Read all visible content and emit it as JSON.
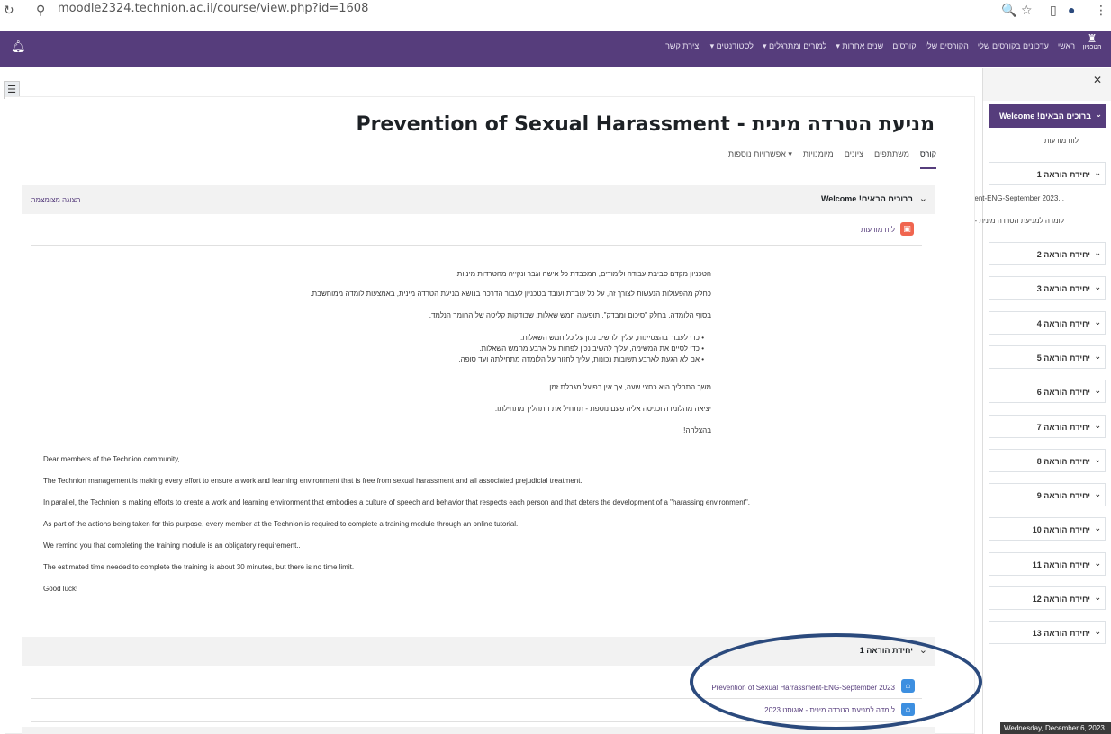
{
  "browser": {
    "url": "moodle2324.technion.ac.il/course/view.php?id=1608"
  },
  "navbar": {
    "logo_text": "הטכניון",
    "items": [
      "ראשי",
      "עדכונים בקורסים שלי",
      "הקורסים שלי",
      "קורסים",
      "שנים אחרות ▾",
      "למורים ומתרגלים ▾",
      "לסטודנטים ▾",
      "יצירת קשר"
    ]
  },
  "course": {
    "title": "מניעת הטרדה מינית - Prevention of Sexual Harassment",
    "tabs": [
      "קורס",
      "משתתפים",
      "ציונים",
      "מיומנויות",
      "אפשרויות נוספות ▾"
    ]
  },
  "welcome_section": {
    "title": "ברוכים הבאים! Welcome",
    "collapse_link": "תצוגה מצומצמת",
    "forum_label": "לוח מודעות",
    "he_paragraphs": [
      "הטכניון מקדם סביבת עבודה ולימודים, המכבדת כל אישה וגבר ונקייה מהטרדות מיניות.",
      "כחלק מהפעולות הנעשות לצורך זה, על כל עובדת ועובד בטכניון לעבור הדרכה בנושא מניעת הטרדה מינית, באמצעות לומדה ממוחשבת.",
      "בסוף הלומדה, בחלק \"סיכום ומבדק\", תופענה חמש שאלות, שבודקות קליטה של החומר הנלמד."
    ],
    "he_list": [
      "כדי לעבור בהצטיינות, עליך להשיב נכון על כל חמש השאלות.",
      "כדי לסיים את המשימה, עליך להשיב נכון לפחות על ארבע מחמש השאלות.",
      "אם לא הגעת לארבע תשובות נכונות, עליך לחזור על הלומדה מתחילתה ועד סופה."
    ],
    "he_after": [
      "משך התהליך הוא כחצי שעה, אך אין בפועל מגבלת זמן.",
      "יציאה מהלומדה וכניסה אליה פעם נוספת - תתחיל את התהליך מתחילתו.",
      "בהצלחה!"
    ],
    "en_paragraphs": [
      "Dear members of the Technion community,",
      "The Technion management is making every effort to ensure a work and learning environment that is free from sexual harassment and all associated prejudicial treatment.",
      "In parallel, the Technion is making efforts to create a work and learning environment that embodies a culture of speech and behavior that respects each person and that deters the development of a \"harassing environment\".",
      "As part of the actions being taken for this purpose, every member at the Technion is required to complete a training module through an online tutorial.",
      "We remind you that completing the training module is an obligatory requirement..",
      "The estimated time needed to complete the training is about 30 minutes, but there is no time limit.",
      "Good luck!"
    ]
  },
  "unit1": {
    "title": "יחידת הוראה 1",
    "activities": [
      "Prevention of Sexual Harrassment-ENG-September 2023",
      "לומדה למניעת הטרדה מינית - אוגוסט 2023"
    ]
  },
  "drawer": {
    "active": "ברוכים הבאים! Welcome",
    "active_sub": "לוח מודעות",
    "unit1_subs": [
      "...ssment-ENG-September 2023",
      "לומדה למניעת הטרדה מינית -..."
    ],
    "units": [
      "יחידת הוראה 1",
      "יחידת הוראה 2",
      "יחידת הוראה 3",
      "יחידת הוראה 4",
      "יחידת הוראה 5",
      "יחידת הוראה 6",
      "יחידת הוראה 7",
      "יחידת הוראה 8",
      "יחידת הוראה 9",
      "יחידת הוראה 10",
      "יחידת הוראה 11",
      "יחידת הוראה 12",
      "יחידת הוראה 13"
    ]
  },
  "tooltip": {
    "date": "Wednesday, December 6, 2023"
  },
  "colors": {
    "brand": "#563d7c",
    "forum_icon": "#f0654f",
    "lesson_icon": "#3d8fe0",
    "annotation_oval": "#2b4a7d"
  }
}
